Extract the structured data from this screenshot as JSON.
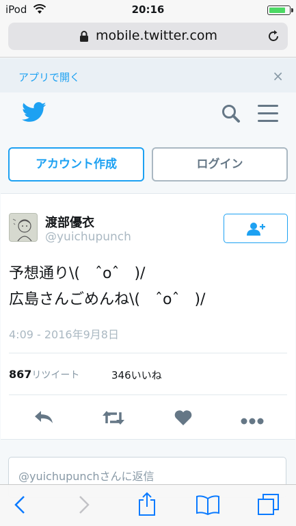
{
  "status_bar": {
    "carrier": "iPod",
    "time": "20:16",
    "battery_level": 0.85
  },
  "browser": {
    "url": "mobile.twitter.com"
  },
  "app_banner": {
    "open_in_app": "アプリで開く",
    "close_icon": "×"
  },
  "header": {
    "logo": "twitter-bird-icon"
  },
  "auth": {
    "signup_label": "アカウント作成",
    "login_label": "ログイン"
  },
  "tweet": {
    "author_name": "渡部優衣",
    "author_handle": "@yuichupunch",
    "text_line1": "予想通り\\(　ˆoˆ　)/",
    "text_line2": "広島さんごめんね\\(　ˆoˆ　)/",
    "timestamp": "4:09 - 2016年9月8日",
    "retweet_count": "867",
    "retweet_label": "リツイート",
    "like_count": "346",
    "like_label": "いいね"
  },
  "reply": {
    "placeholder": "@yuichupunchさんに返信"
  },
  "colors": {
    "accent": "#1da1f2",
    "muted": "#8899a6",
    "ios_blue": "#0a7aff"
  }
}
